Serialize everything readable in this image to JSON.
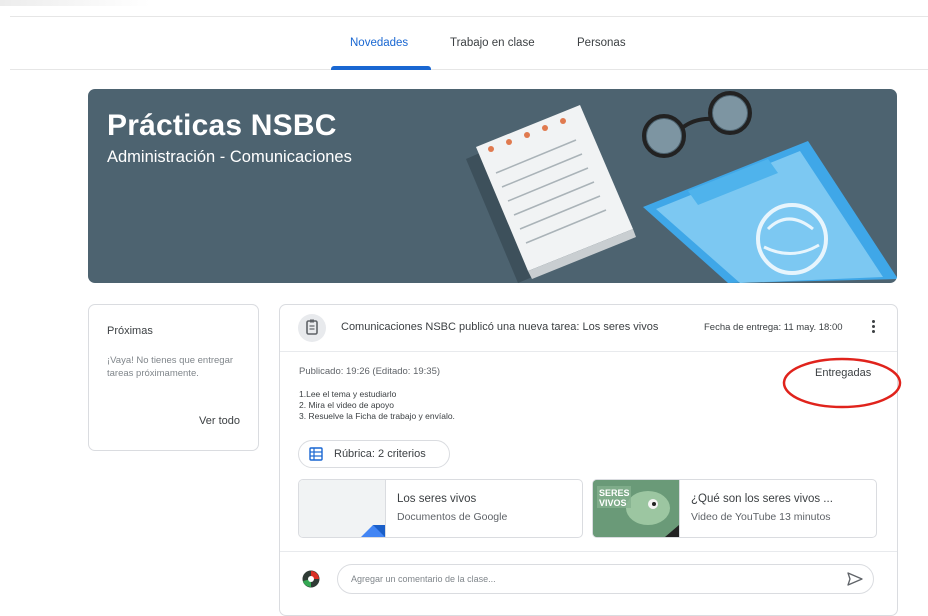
{
  "tabs": [
    {
      "label": "Novedades",
      "active": true
    },
    {
      "label": "Trabajo en clase",
      "active": false
    },
    {
      "label": "Personas",
      "active": false
    }
  ],
  "banner": {
    "title": "Prácticas NSBC",
    "subtitle": "Administración - Comunicaciones"
  },
  "upcoming": {
    "title": "Próximas",
    "text": "¡Vaya! No tienes que entregar tareas próximamente.",
    "link": "Ver todo"
  },
  "post": {
    "icon": "assignment-icon",
    "title": "Comunicaciones NSBC publicó una nueva tarea: Los seres vivos",
    "due": "Fecha de entrega: 11 may. 18:00",
    "posted": "Publicado: 19:26 (Editado: 19:35)",
    "status_link": "Entregadas",
    "instructions": [
      "1.Lee el tema y estudiarlo",
      "2. Mira el video de apoyo",
      "3. Resuelve la Ficha de trabajo y envíalo."
    ],
    "rubric": "Rúbrica: 2 criterios",
    "attachments": [
      {
        "title": "Los seres vivos",
        "subtitle": "Documentos de Google"
      },
      {
        "title": "¿Qué son los seres vivos ...",
        "subtitle": "Video de YouTube   13 minutos",
        "thumb_text": "SERES VIVOS"
      }
    ],
    "comment_placeholder": "Agregar un comentario de la clase..."
  },
  "colors": {
    "accent": "#1967d2",
    "banner": "#4d6370",
    "annotation": "#e0231c"
  }
}
